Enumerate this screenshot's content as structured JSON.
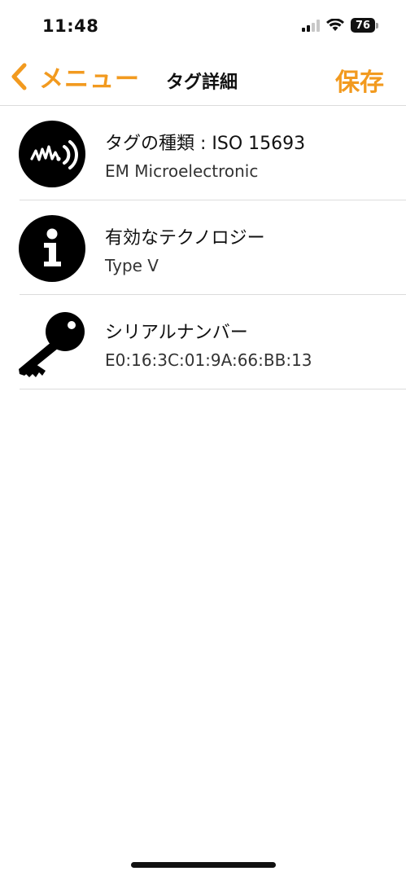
{
  "status_bar": {
    "time": "11:48",
    "battery": "76"
  },
  "nav": {
    "back_label": "メニュー",
    "title": "タグ詳細",
    "save_label": "保存"
  },
  "colors": {
    "accent": "#f29a1f"
  },
  "rows": [
    {
      "icon": "nfc-wave-icon",
      "title": "タグの種類 : ISO 15693",
      "value": "EM Microelectronic"
    },
    {
      "icon": "info-icon",
      "title": "有効なテクノロジー",
      "value": "Type V"
    },
    {
      "icon": "key-icon",
      "title": "シリアルナンバー",
      "value": "E0:16:3C:01:9A:66:BB:13"
    }
  ]
}
